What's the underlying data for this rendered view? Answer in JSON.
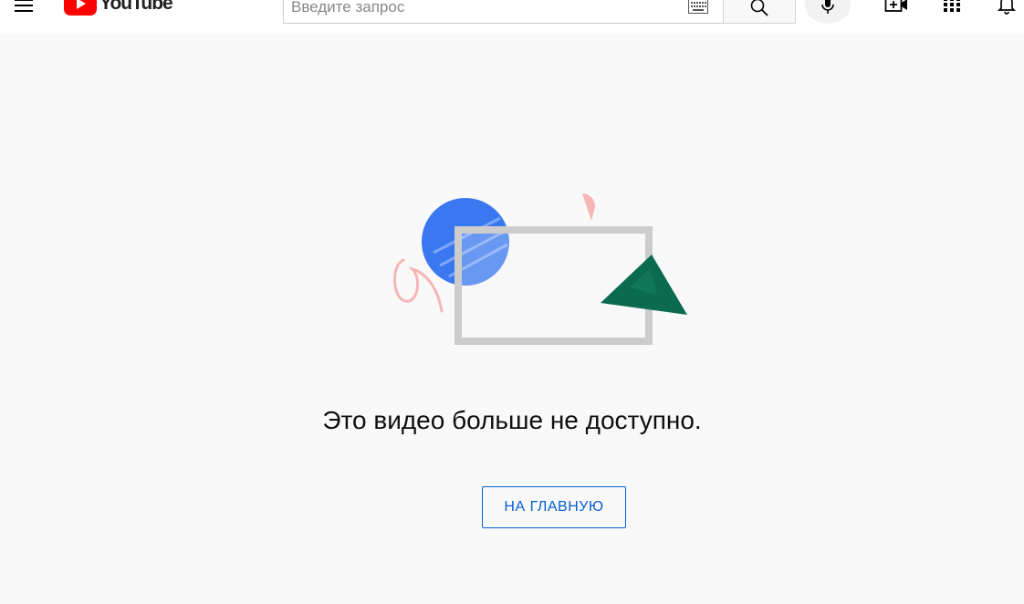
{
  "header": {
    "logo_text": "YouTube",
    "search": {
      "placeholder": "Введите запрос",
      "value": ""
    }
  },
  "icons": {
    "menu": "hamburger-menu-icon",
    "keyboard": "keyboard-icon",
    "search": "search-icon",
    "mic": "microphone-icon",
    "create": "create-video-icon",
    "apps": "apps-grid-icon",
    "notifications": "bell-icon"
  },
  "colors": {
    "brand_red": "#ff0000",
    "link_blue": "#065fd4",
    "illustration_blue": "#3a78f2",
    "illustration_green": "#0b6b4f",
    "illustration_pink": "#f7b6b6",
    "frame_gray": "#cccccc"
  },
  "main": {
    "message": "Это видео больше не доступно.",
    "home_button_label": "НА ГЛАВНУЮ"
  }
}
